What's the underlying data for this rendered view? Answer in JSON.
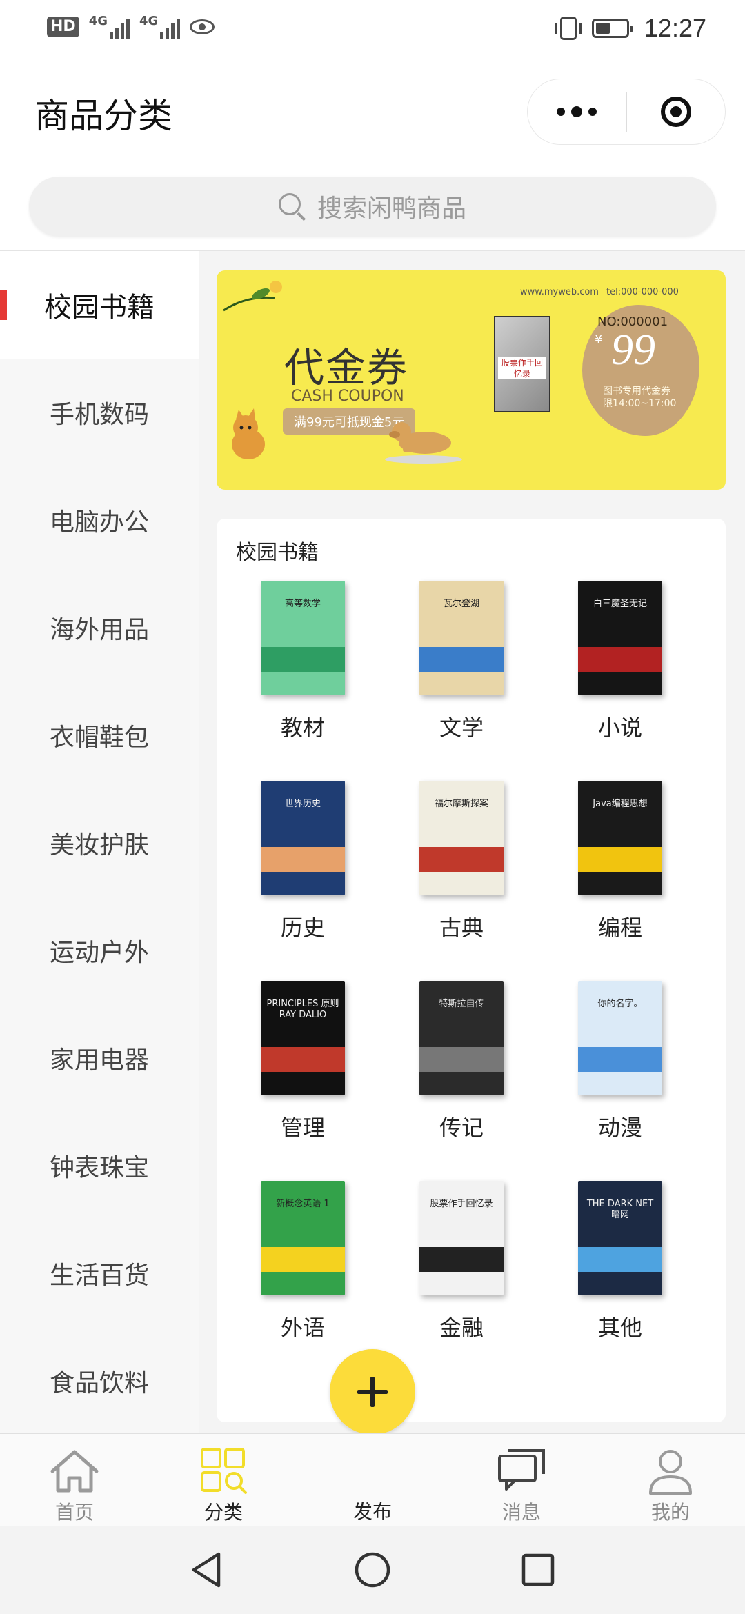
{
  "status_bar": {
    "hd_label": "HD",
    "network_1": "4G",
    "network_2": "4G",
    "time": "12:27",
    "battery_level": 0.45
  },
  "header": {
    "title": "商品分类"
  },
  "search": {
    "placeholder": "搜索闲鸭商品"
  },
  "sidebar": {
    "active_index": 0,
    "items": [
      {
        "label": "校园书籍"
      },
      {
        "label": "手机数码"
      },
      {
        "label": "电脑办公"
      },
      {
        "label": "海外用品"
      },
      {
        "label": "衣帽鞋包"
      },
      {
        "label": "美妆护肤"
      },
      {
        "label": "运动户外"
      },
      {
        "label": "家用电器"
      },
      {
        "label": "钟表珠宝"
      },
      {
        "label": "生活百货"
      },
      {
        "label": "食品饮料"
      }
    ]
  },
  "banner": {
    "website": "www.myweb.com",
    "tel": "tel:000-000-000",
    "title": "代金券",
    "subtitle": "CASH COUPON",
    "condition": "满99元可抵现金5元",
    "book_title": "股票作手回忆录",
    "coupon_no": "NO:000001",
    "currency": "¥",
    "amount": "99",
    "note_1": "图书专用代金券",
    "note_2": "限14:00~17:00"
  },
  "category_section": {
    "title": "校园书籍",
    "items": [
      {
        "label": "教材",
        "cover_text": "高等数学",
        "cover_color": "#6fcf9c",
        "band_color": "#2e9e63"
      },
      {
        "label": "文学",
        "cover_text": "瓦尔登湖",
        "cover_color": "#e8d6a8",
        "band_color": "#3a7dc9"
      },
      {
        "label": "小说",
        "cover_text": "白三魔圣无记",
        "cover_color": "#151515",
        "band_color": "#b22222"
      },
      {
        "label": "历史",
        "cover_text": "世界历史",
        "cover_color": "#1f3d73",
        "band_color": "#e7a16a"
      },
      {
        "label": "古典",
        "cover_text": "福尔摩斯探案",
        "cover_color": "#f0ede0",
        "band_color": "#c0392b"
      },
      {
        "label": "编程",
        "cover_text": "Java编程思想",
        "cover_color": "#1a1a1a",
        "band_color": "#f1c40f"
      },
      {
        "label": "管理",
        "cover_text": "PRINCIPLES 原则 RAY DALIO",
        "cover_color": "#111111",
        "band_color": "#c0392b"
      },
      {
        "label": "传记",
        "cover_text": "特斯拉自传",
        "cover_color": "#2b2b2b",
        "band_color": "#777777"
      },
      {
        "label": "动漫",
        "cover_text": "你的名字。",
        "cover_color": "#dbeaf7",
        "band_color": "#4a90d9"
      },
      {
        "label": "外语",
        "cover_text": "新概念英语 1",
        "cover_color": "#33a24a",
        "band_color": "#f4d21f"
      },
      {
        "label": "金融",
        "cover_text": "股票作手回忆录",
        "cover_color": "#f2f2f2",
        "band_color": "#222222"
      },
      {
        "label": "其他",
        "cover_text": "THE DARK NET 暗网",
        "cover_color": "#1c2a44",
        "band_color": "#4ea3e0"
      }
    ]
  },
  "tabbar": {
    "active": "category",
    "items": [
      {
        "key": "home",
        "label": "首页",
        "icon": "home-icon"
      },
      {
        "key": "category",
        "label": "分类",
        "icon": "category-grid-icon"
      },
      {
        "key": "publish",
        "label": "发布",
        "icon": "plus-icon"
      },
      {
        "key": "messages",
        "label": "消息",
        "icon": "chat-icon"
      },
      {
        "key": "mine",
        "label": "我的",
        "icon": "user-icon"
      }
    ]
  },
  "colors": {
    "accent": "#fcdc3a",
    "active_marker": "#e53935",
    "banner_bg": "#f7ea4f",
    "tab_inactive": "#8a8a8a"
  }
}
